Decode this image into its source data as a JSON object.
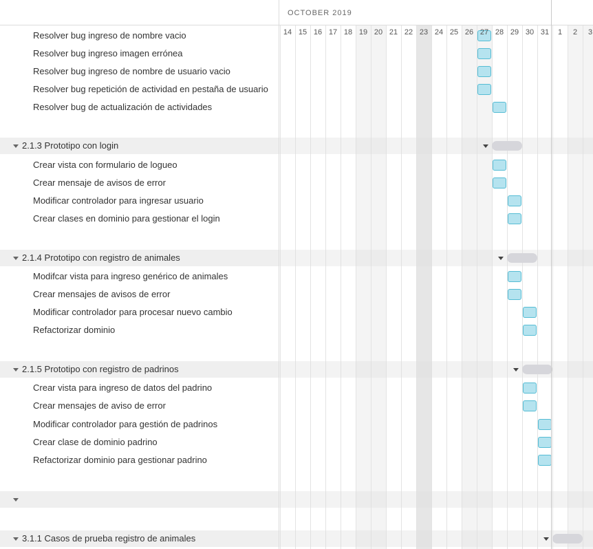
{
  "timeline": {
    "month_label": "OCTOBER 2019",
    "days": [
      {
        "label": "14",
        "type": "weekday"
      },
      {
        "label": "15",
        "type": "weekday"
      },
      {
        "label": "16",
        "type": "weekday"
      },
      {
        "label": "17",
        "type": "weekday"
      },
      {
        "label": "18",
        "type": "weekday"
      },
      {
        "label": "19",
        "type": "weekend"
      },
      {
        "label": "20",
        "type": "weekend"
      },
      {
        "label": "21",
        "type": "weekday"
      },
      {
        "label": "22",
        "type": "weekday"
      },
      {
        "label": "23",
        "type": "today"
      },
      {
        "label": "24",
        "type": "weekday"
      },
      {
        "label": "25",
        "type": "weekday"
      },
      {
        "label": "26",
        "type": "weekend"
      },
      {
        "label": "27",
        "type": "weekend"
      },
      {
        "label": "28",
        "type": "weekday"
      },
      {
        "label": "29",
        "type": "weekday"
      },
      {
        "label": "30",
        "type": "weekday"
      },
      {
        "label": "31",
        "type": "weekday"
      },
      {
        "label": "1",
        "type": "weekday"
      },
      {
        "label": "2",
        "type": "weekend"
      },
      {
        "label": "3",
        "type": "weekend"
      }
    ]
  },
  "rows": [
    {
      "kind": "task",
      "label": "Resolver bug ingreso de nombre vacio",
      "start": "27",
      "end": "27"
    },
    {
      "kind": "task",
      "label": "Resolver bug ingreso imagen errónea",
      "start": "27",
      "end": "27"
    },
    {
      "kind": "task",
      "label": "Resolver bug ingreso de nombre de usuario vacio",
      "start": "27",
      "end": "27"
    },
    {
      "kind": "task",
      "label": "Resolver bug repetición de actividad en pestaña de usuario",
      "start": "27",
      "end": "27"
    },
    {
      "kind": "task",
      "label": "Resolver bug de actualización de actividades",
      "start": "28",
      "end": "28"
    },
    {
      "kind": "blank",
      "label": ""
    },
    {
      "kind": "section",
      "label": "2.1.3 Prototipo con login",
      "start": "28",
      "end": "29"
    },
    {
      "kind": "task",
      "label": "Crear vista con formulario de logueo",
      "start": "28",
      "end": "28"
    },
    {
      "kind": "task",
      "label": "Crear mensaje de avisos de error",
      "start": "28",
      "end": "28"
    },
    {
      "kind": "task",
      "label": "Modificar controlador para ingresar usuario",
      "start": "29",
      "end": "29"
    },
    {
      "kind": "task",
      "label": "Crear clases en dominio para gestionar el login",
      "start": "29",
      "end": "29"
    },
    {
      "kind": "blank",
      "label": ""
    },
    {
      "kind": "section",
      "label": "2.1.4 Prototipo con registro de animales",
      "start": "29",
      "end": "30"
    },
    {
      "kind": "task",
      "label": "Modifcar vista para ingreso genérico de animales",
      "start": "29",
      "end": "29"
    },
    {
      "kind": "task",
      "label": "Crear mensajes de avisos de error",
      "start": "29",
      "end": "29"
    },
    {
      "kind": "task",
      "label": "Modificar controlador para procesar nuevo cambio",
      "start": "30",
      "end": "30"
    },
    {
      "kind": "task",
      "label": "Refactorizar dominio",
      "start": "30",
      "end": "30"
    },
    {
      "kind": "blank",
      "label": ""
    },
    {
      "kind": "section",
      "label": "2.1.5 Prototipo con registro de padrinos",
      "start": "30",
      "end": "31"
    },
    {
      "kind": "task",
      "label": "Crear vista para ingreso de datos del padrino",
      "start": "30",
      "end": "30"
    },
    {
      "kind": "task",
      "label": "Crear mensajes de aviso de error",
      "start": "30",
      "end": "30"
    },
    {
      "kind": "task",
      "label": "Modificar controlador para gestión de padrinos",
      "start": "31",
      "end": "31"
    },
    {
      "kind": "task",
      "label": "Crear clase de dominio padrino",
      "start": "31",
      "end": "31"
    },
    {
      "kind": "task",
      "label": "Refactorizar dominio para gestionar padrino",
      "start": "31",
      "end": "31"
    },
    {
      "kind": "blank",
      "label": ""
    },
    {
      "kind": "blank",
      "label": ""
    },
    {
      "kind": "section-empty",
      "label": ""
    },
    {
      "kind": "blank",
      "label": ""
    },
    {
      "kind": "section",
      "label": "3.1.1 Casos de prueba registro de animales",
      "start": "1",
      "end": "2"
    }
  ]
}
